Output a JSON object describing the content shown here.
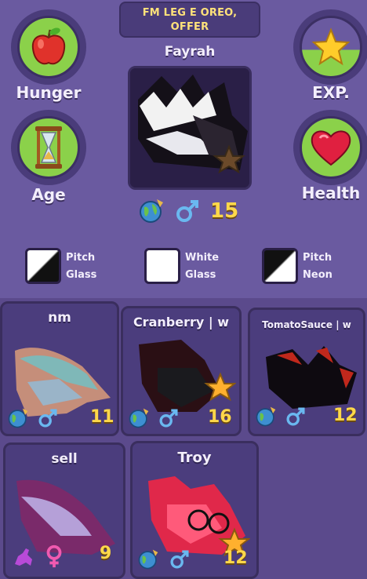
{
  "trade": {
    "banner_line1": "FM LEG E OREO,",
    "banner_line2": "OFFER"
  },
  "pet": {
    "name": "Fayrah",
    "age": "15",
    "stats": {
      "hunger_label": "Hunger",
      "exp_label": "EXP.",
      "age_label": "Age",
      "health_label": "Health"
    },
    "traits": [
      {
        "line1": "Pitch",
        "line2": "Glass"
      },
      {
        "line1": "White",
        "line2": "Glass"
      },
      {
        "line1": "Pitch",
        "line2": "Neon"
      }
    ]
  },
  "inventory": [
    {
      "name": "nm",
      "age": "11",
      "gender": "male"
    },
    {
      "name": "Cranberry | w",
      "age": "16",
      "gender": "male"
    },
    {
      "name": "TomatoSauce | w",
      "age": "12",
      "gender": "male"
    },
    {
      "name": "sell",
      "age": "9",
      "gender": "female"
    },
    {
      "name": "Troy",
      "age": "12",
      "gender": "male"
    }
  ],
  "icons": {
    "hunger": "apple-icon",
    "exp": "star-icon",
    "age": "hourglass-icon",
    "health": "heart-icon",
    "region": "globe-icon",
    "male": "male-icon",
    "female": "female-icon"
  },
  "colors": {
    "age_number": "#ffd84a",
    "stat_fill": "#8bd14a",
    "background": "#5b4a8c"
  }
}
